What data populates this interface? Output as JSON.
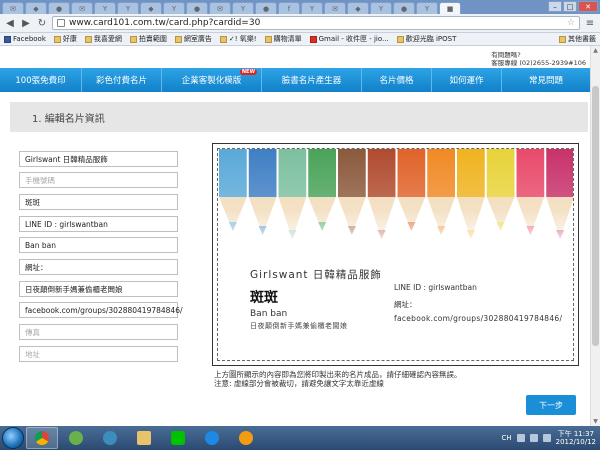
{
  "browser": {
    "url": "www.card101.com.tw/card.php?cardid=30",
    "bookmarks": [
      "Facebook",
      "好康",
      "我喜愛網",
      "拍賣範圍",
      "網室廣告",
      "✓! 氧樂!",
      "購物清單",
      "Gmail - 收件匣 - jio...",
      "歡迎光臨 iPOST"
    ],
    "other_bookmarks": "其他書籤"
  },
  "site": {
    "contact_line1": "有問題嗎?",
    "contact_line2": "客服專線 (02)2655-2939#106",
    "menu": [
      "100張免費印",
      "彩色付費名片",
      "企業客製化模版",
      "臉書名片產生器",
      "名片價格",
      "如何運作",
      "常見問題"
    ],
    "new_badge": "NEW"
  },
  "section": {
    "title": "1. 編輯名片資訊"
  },
  "form": {
    "fields": [
      {
        "value": "Girlswant 日韓精品服飾",
        "placeholder": false
      },
      {
        "value": "手機號碼",
        "placeholder": true
      },
      {
        "value": "斑斑",
        "placeholder": false
      },
      {
        "value": "LINE ID :   girlswantban",
        "placeholder": false
      },
      {
        "value": "Ban ban",
        "placeholder": false
      },
      {
        "value": "網址：",
        "placeholder": false
      },
      {
        "value": "日夜顛倒新手媽兼偷櫃老闆娘",
        "placeholder": false
      },
      {
        "value": "facebook.com/groups/302880419784846/",
        "placeholder": false
      },
      {
        "value": "傳真",
        "placeholder": true
      },
      {
        "value": "地址",
        "placeholder": true
      }
    ]
  },
  "card": {
    "company": "Girlswant 日韓精品服飾",
    "name": "斑斑",
    "name_en": "Ban ban",
    "slogan": "日夜顛倒新手媽兼偷櫃老闆娘",
    "line_id": "LINE ID :   girlswantban",
    "address_label": "網址：",
    "facebook": "facebook.com/groups/302880419784846/",
    "pencil_colors": [
      "#5aa9d8",
      "#3f7fc4",
      "#7cc0a0",
      "#4aa35a",
      "#8b5a3c",
      "#b04b2f",
      "#e0632a",
      "#f08a25",
      "#f0b320",
      "#e8d33a",
      "#e94a6a",
      "#c8326a"
    ]
  },
  "note": {
    "line1": "上方圖所顯示的內容即為您將印製出來的名片成品，請仔細確認內容無誤。",
    "line2": "注意: 虛線部分會被裁切，請避免讓文字太靠近虛線"
  },
  "next_button": "下一步",
  "taskbar": {
    "lang": "CH",
    "time": "下午 11:37",
    "date": "2012/10/12"
  }
}
